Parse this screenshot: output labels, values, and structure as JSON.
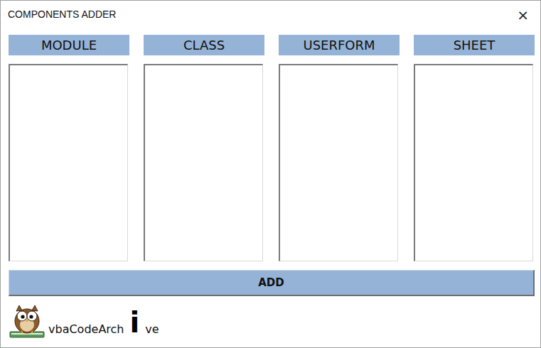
{
  "window": {
    "title": "COMPONENTS ADDER",
    "close": "×"
  },
  "columns": [
    {
      "header": "MODULE"
    },
    {
      "header": "CLASS"
    },
    {
      "header": "USERFORM"
    },
    {
      "header": "SHEET"
    }
  ],
  "button": "ADD",
  "logo": {
    "parts": [
      "vbaCodeArch",
      "i",
      "ve"
    ]
  }
}
